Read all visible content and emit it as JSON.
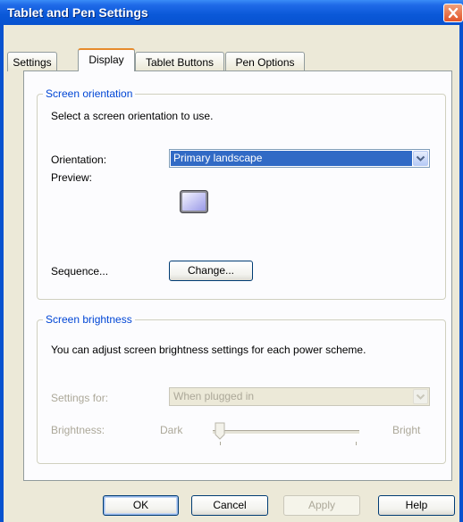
{
  "window": {
    "title": "Tablet and Pen Settings"
  },
  "tabs": [
    {
      "label": "Settings",
      "active": false
    },
    {
      "label": "Display",
      "active": true
    },
    {
      "label": "Tablet Buttons",
      "active": false
    },
    {
      "label": "Pen Options",
      "active": false
    }
  ],
  "screen_orientation": {
    "legend": "Screen orientation",
    "description": "Select a screen orientation to use.",
    "orientation_label": "Orientation:",
    "orientation_value": "Primary landscape",
    "preview_label": "Preview:",
    "sequence_label": "Sequence...",
    "change_button": "Change..."
  },
  "screen_brightness": {
    "legend": "Screen brightness",
    "description": "You can adjust screen brightness settings for each power scheme.",
    "settings_for_label": "Settings for:",
    "settings_for_value": "When plugged in",
    "brightness_label": "Brightness:",
    "dark_label": "Dark",
    "bright_label": "Bright",
    "enabled": false
  },
  "buttons": {
    "ok": "OK",
    "cancel": "Cancel",
    "apply": "Apply",
    "help": "Help"
  },
  "icons": {
    "close": "close-icon",
    "combo_arrow": "chevron-down-icon",
    "preview": "monitor-preview-icon",
    "slider_thumb": "slider-thumb-icon"
  },
  "colors": {
    "titlebar": "#0a58d8",
    "close_button": "#e2542a",
    "group_legend": "#0046d5",
    "active_tab_highlight": "#e68b2c",
    "selection": "#316ac5",
    "disabled_text": "#aca899"
  }
}
